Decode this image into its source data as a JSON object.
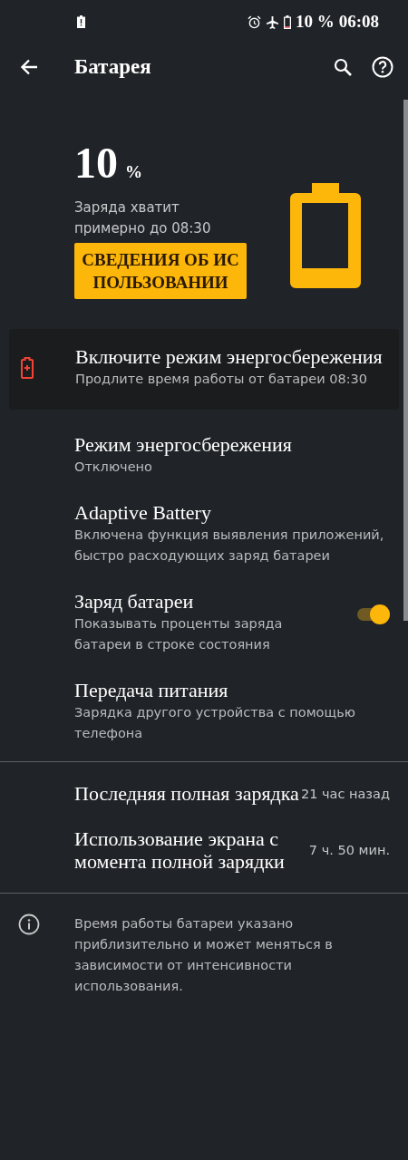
{
  "status_bar": {
    "battery_text": "10 %",
    "time": "06:08"
  },
  "app_bar": {
    "title": "Батарея"
  },
  "summary": {
    "percent": "10",
    "unit": "%",
    "estimate": "Заряда хватит примерно до 08:30",
    "button": "СВЕДЕНИЯ ОБ ИСПОЛЬЗОВАНИИ"
  },
  "tip": {
    "title": "Включите режим энергосбережения",
    "summary": "Продлите время работы от батареи 08:30"
  },
  "settings": [
    {
      "kind": "item",
      "title": "Режим энергосбережения",
      "summary": "Отключено"
    },
    {
      "kind": "item",
      "title": "Adaptive Battery",
      "summary": "Включена функция выявления приложений, быстро расходующих заряд батареи"
    },
    {
      "kind": "toggle",
      "title": "Заряд батареи",
      "summary": "Показывать проценты заряда батареи в строке состояния",
      "on": true
    },
    {
      "kind": "item",
      "title": "Передача питания",
      "summary": "Зарядка другого устройства с помощью телефона"
    }
  ],
  "stats": [
    {
      "title": "Последняя полная зарядка",
      "value": "21 час назад"
    },
    {
      "title": "Использование экрана с момента полной зарядки",
      "value": "7 ч. 50 мин."
    }
  ],
  "footer": {
    "text": "Время работы батареи указано приблизительно и может меняться в зависимости от интенсивности использования."
  }
}
